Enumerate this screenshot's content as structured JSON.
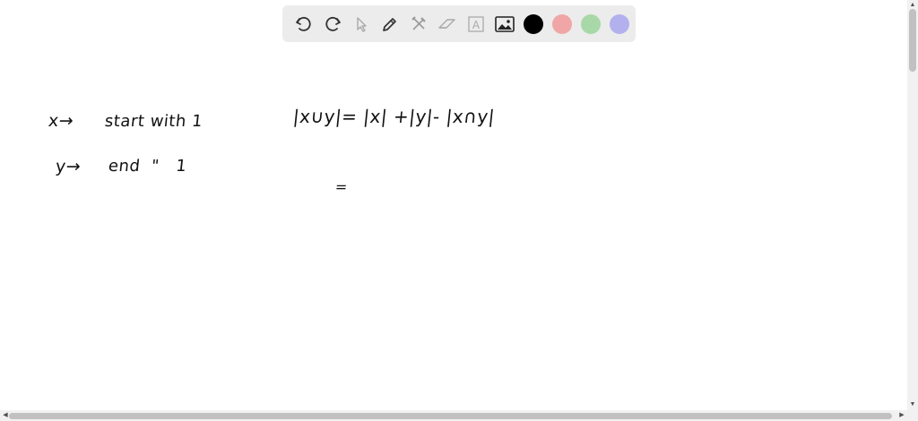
{
  "toolbar": {
    "tools": [
      {
        "name": "undo-icon"
      },
      {
        "name": "redo-icon"
      },
      {
        "name": "select-arrow-icon"
      },
      {
        "name": "pen-icon"
      },
      {
        "name": "tools-icon"
      },
      {
        "name": "eraser-icon"
      },
      {
        "name": "text-icon"
      },
      {
        "name": "image-icon"
      }
    ],
    "colors": {
      "black": "#000000",
      "red": "#f0a6a6",
      "green": "#a8d8a8",
      "purple": "#b3b0ee"
    },
    "text_tool_glyph": "A"
  },
  "notes": {
    "line1_label": "x→",
    "line1_text": "start with 1",
    "line2_label": "y→",
    "line2_text": "end  \"   1",
    "formula": "|x∪y|= |x| +|y|- |x∩y|",
    "equals": "="
  },
  "scrollbars": {
    "left_arrow": "◀",
    "right_arrow": "▶",
    "up_arrow": "▲",
    "down_arrow": "▼"
  }
}
